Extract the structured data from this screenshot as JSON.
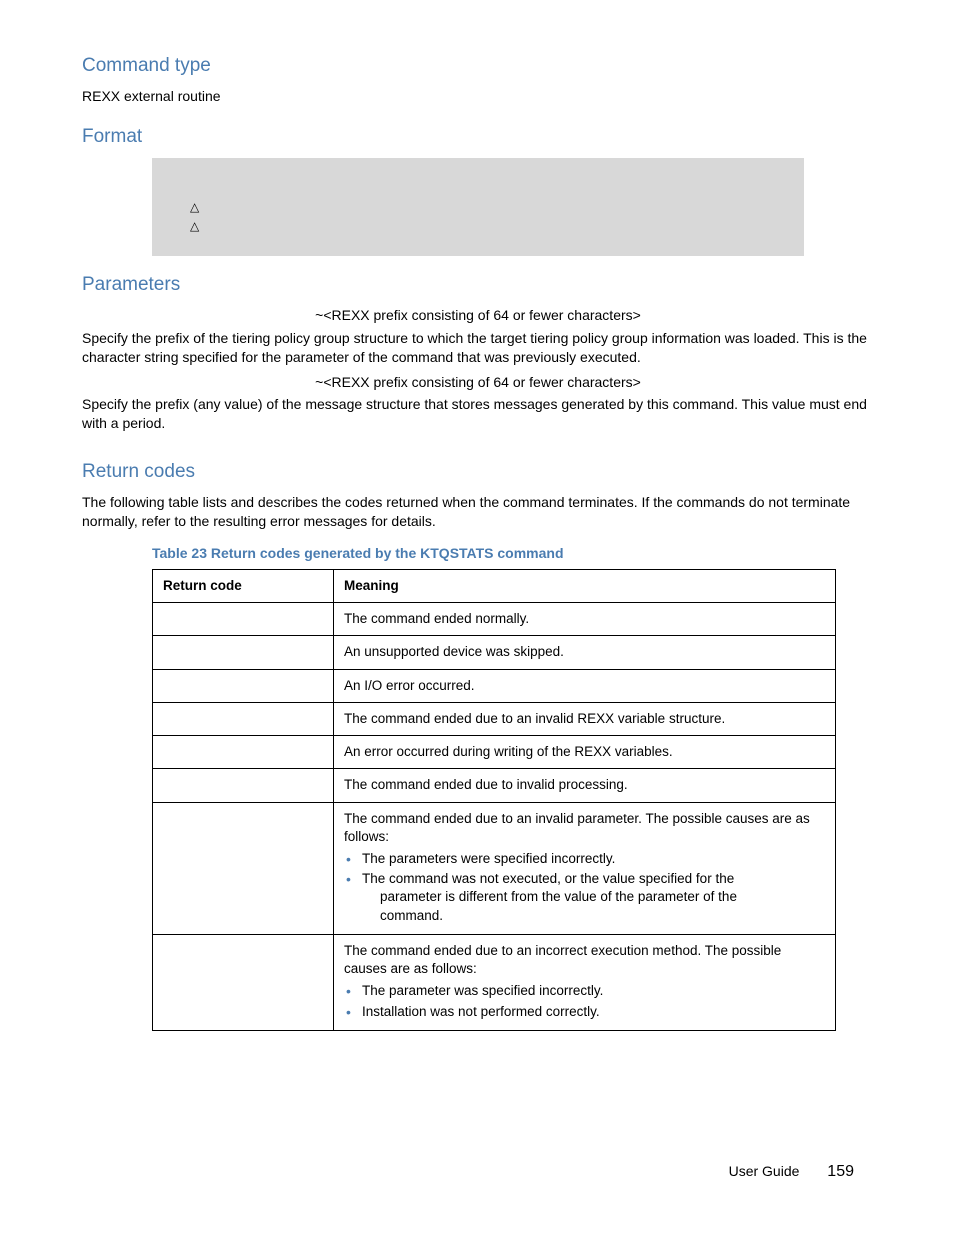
{
  "sections": {
    "command_type": {
      "heading": "Command type",
      "body": "REXX external routine"
    },
    "format": {
      "heading": "Format",
      "tri1": "△",
      "tri2": "△"
    },
    "parameters": {
      "heading": "Parameters",
      "p1_label": "~<REXX prefix consisting of 64 or fewer characters>",
      "p1_body_a": "Specify the prefix of the tiering policy group structure to which the target tiering policy group in­formation was loaded. This is the character string specified for the ",
      "p1_body_b": " parameter of the ",
      "p1_body_c": " command that was previously executed.",
      "p2_label": "~<REXX prefix consisting of 64 or fewer characters>",
      "p2_body": "Specify the prefix (any value) of the message structure that stores messages generated by this command. This value must end with a period."
    },
    "return_codes": {
      "heading": "Return codes",
      "intro_a": "The following table lists and describes the codes returned when the ",
      "intro_b": " command terminates. If the commands do not terminate normally, refer to the resulting error messages for details.",
      "caption": "Table 23 Return codes generated by the KTQSTATS command",
      "th1": "Return code",
      "th2": "Meaning",
      "rows": [
        {
          "code": "",
          "meaning": "The command ended normally."
        },
        {
          "code": "",
          "meaning": "An unsupported device was skipped."
        },
        {
          "code": "",
          "meaning": "An I/O error occurred."
        },
        {
          "code": "",
          "meaning": "The command ended due to an invalid REXX variable structure."
        },
        {
          "code": "",
          "meaning": "An error occurred during writing of the REXX variables."
        },
        {
          "code": "",
          "meaning": "The command ended due to invalid processing."
        }
      ],
      "row7": {
        "intro": "The command ended due to an invalid parameter. The possible causes are as follows:",
        "b1": "The parameters were specified incorrectly.",
        "b2_a": "The ",
        "b2_b": " command was not executed, or the value specified for the ",
        "b2_c": " parameter is different from the value of the ",
        "b2_d": " parameter of the ",
        "b2_e": " command."
      },
      "row8": {
        "intro": "The command ended due to an incorrect execution method. The possible causes are as follows:",
        "b1_a": "The ",
        "b1_b": " parameter was specified incorrectly.",
        "b2": "Installation was not performed correctly."
      }
    }
  },
  "footer": {
    "label": "User Guide",
    "page": "159"
  }
}
